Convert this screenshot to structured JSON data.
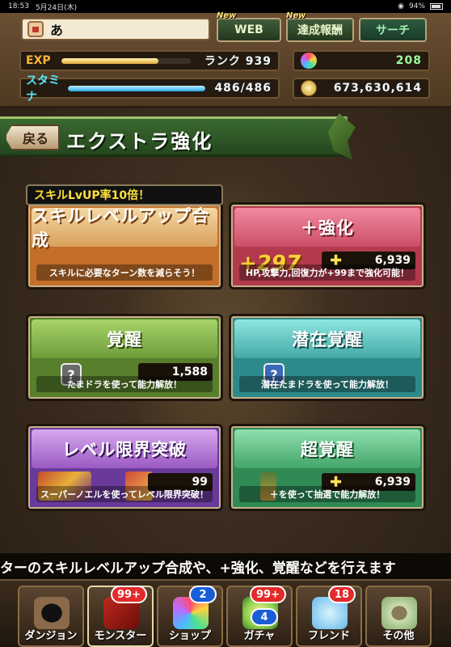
{
  "status_bar": {
    "time": "18:53",
    "date": "5月24日(木)",
    "battery": "94%"
  },
  "header": {
    "player_name": "あ",
    "web_label": "WEB",
    "new_label_1": "New",
    "achievement_label": "達成報酬",
    "new_label_2": "New",
    "search_label": "サーチ",
    "exp_label": "EXP",
    "rank_text": "ランク 939",
    "stamina_label": "スタミナ",
    "stamina_value": "486/486",
    "exp_progress": 0.75,
    "stamina_progress": 1.0,
    "magic_stones": "208",
    "coins": "673,630,614"
  },
  "title": {
    "back_label": "戻る",
    "page_title": "エクストラ強化"
  },
  "banner": {
    "text": "スキルLvUP率10倍！"
  },
  "cards": {
    "skill_up": {
      "title": "スキルレベルアップ合成",
      "desc": "スキルに必要なターン数を減らそう！"
    },
    "plus": {
      "title": "＋強化",
      "count": "6,939",
      "desc": "HP,攻撃力,回復力が+99まで強化可能！",
      "big_plus": "+297"
    },
    "awaken": {
      "title": "覚醒",
      "count": "1,588",
      "desc": "たまドラを使って能力解放！"
    },
    "latent": {
      "title": "潜在覚醒",
      "desc": "潜在たまドラを使って能力解放！"
    },
    "limit_break": {
      "title": "レベル限界突破",
      "count": "99",
      "desc": "スーパーノエルを使ってレベル限界突破！"
    },
    "super_awaken": {
      "title": "超覚醒",
      "count": "6,939",
      "desc": "＋を使って抽選で能力解放！"
    }
  },
  "marquee": {
    "text": "ターのスキルレベルアップ合成や、+強化、覚醒などを行えます"
  },
  "nav": [
    {
      "label": "ダンジョン"
    },
    {
      "label": "モンスター",
      "badge": "99+"
    },
    {
      "label": "ショップ",
      "badge": "2"
    },
    {
      "label": "ガチャ",
      "badge": "99+",
      "badge2": "4"
    },
    {
      "label": "フレンド",
      "badge": "18"
    },
    {
      "label": "その他"
    }
  ],
  "colors": {
    "exp": "#ffb43a",
    "stamina": "#59e6ff",
    "badge_red": "#e22a2a",
    "badge_blue": "#1a5ed6"
  }
}
